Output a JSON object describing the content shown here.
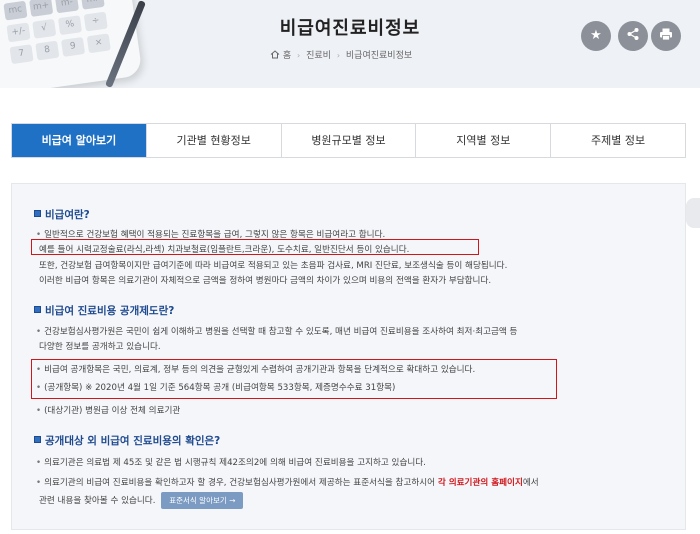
{
  "header": {
    "title": "비급여진료비정보",
    "breadcrumb": {
      "home": "홈",
      "level1": "진료비",
      "level2": "비급여진료비정보"
    },
    "calc_keys": [
      "mc",
      "m+",
      "m-",
      "mr",
      "+/-",
      "√",
      "%",
      "÷",
      "7",
      "8",
      "9",
      "×"
    ],
    "actions": {
      "favorite_icon": "star-icon",
      "share_icon": "share-icon",
      "print_icon": "print-icon"
    }
  },
  "tabs": [
    {
      "label": "비급여 알아보기",
      "active": true
    },
    {
      "label": "기관별 현황정보",
      "active": false
    },
    {
      "label": "병원규모별 정보",
      "active": false
    },
    {
      "label": "지역별 정보",
      "active": false
    },
    {
      "label": "주제별 정보",
      "active": false
    }
  ],
  "section1": {
    "title": "비급여란?",
    "lines": [
      "일반적으로 건강보험 혜택이 적용되는 진료항목을 급여, 그렇지 않은 항목은 비급여라고 합니다.",
      "예를 들어 시력교정술료(라식,라섹) 치과보철료(임플란트,크라운), 도수치료, 일반진단서 등이 있습니다.",
      "또한, 건강보험 급여항목이지만 급여기준에 따라 비급여로 적용되고 있는 초음파 검사료, MRI 진단료, 보조생식술 등이 해당됩니다.",
      "이러한 비급여 항목은 의료기관이 자체적으로 금액을 정하여 병원마다 금액의 차이가 있으며 비용의 전액을 환자가 부담합니다."
    ]
  },
  "section2": {
    "title": "비급여 진료비용 공개제도란?",
    "lines": [
      "건강보험심사평가원은 국민이 쉽게 이해하고 병원을 선택할 때 참고할 수 있도록, 매년 비급여 진료비용을 조사하여 최저·최고금액 등",
      "다양한 정보를 공개하고 있습니다.",
      "비급여 공개항목은 국민, 의료계, 정부 등의 의견을 균형있게 수렴하여 공개기관과 항목을 단계적으로 확대하고 있습니다.",
      "(공개항목) ※ 2020년 4월 1일 기준 564항목 공개 (비급여항목 533항목, 제증명수수료 31항목)",
      "(대상기관) 병원급 이상 전체 의료기관"
    ]
  },
  "section3": {
    "title": "공개대상 외 비급여 진료비용의 확인은?",
    "line1": "의료기관은 의료법 제 45조 및 같은 법 시행규칙 제42조의2에 의해 비급여 진료비용을 고지하고 있습니다.",
    "line2_pre": "의료기관의 비급여 진료비용을 확인하고자 할 경우, 건강보험심사평가원에서 제공하는 표준서식을 참고하시어 ",
    "line2_red": "각 의료기관의 홈페이지",
    "line2_post": "에서",
    "line3": "관련 내용을 찾아볼 수 있습니다.",
    "button_label": "표준서식 알아보기",
    "button_arrow": "→"
  },
  "colors": {
    "accent": "#1f71c5",
    "highlight": "#d0161b",
    "section_title": "#1f4a8f"
  }
}
